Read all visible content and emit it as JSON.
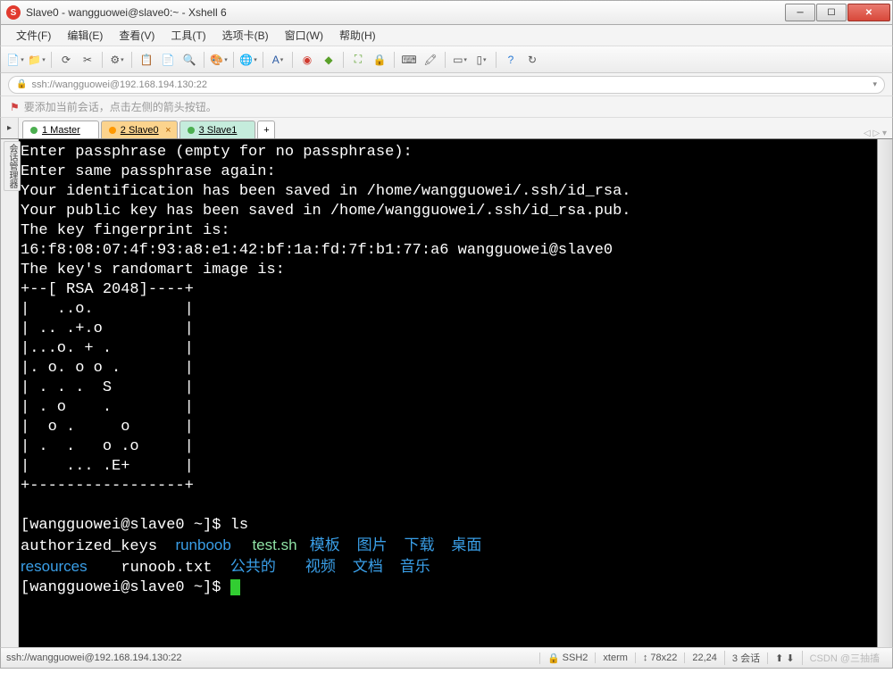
{
  "window": {
    "title": "Slave0 - wangguowei@slave0:~ - Xshell 6",
    "app_icon_glyph": "S"
  },
  "menubar": [
    "文件(F)",
    "编辑(E)",
    "查看(V)",
    "工具(T)",
    "选项卡(B)",
    "窗口(W)",
    "帮助(H)"
  ],
  "addressbar": {
    "text": "ssh://wangguowei@192.168.194.130:22"
  },
  "hint": "要添加当前会话，点击左侧的箭头按钮。",
  "side_handle_label": "会话管理器",
  "tabs": [
    {
      "id": "master",
      "label": "1 Master",
      "state": "green",
      "active": false
    },
    {
      "id": "slave0",
      "label": "2 Slave0",
      "state": "orange",
      "active": true
    },
    {
      "id": "slave1",
      "label": "3 Slave1",
      "state": "green",
      "active": false
    }
  ],
  "terminal": {
    "lines": [
      "Enter passphrase (empty for no passphrase):",
      "Enter same passphrase again:",
      "Your identification has been saved in /home/wangguowei/.ssh/id_rsa.",
      "Your public key has been saved in /home/wangguowei/.ssh/id_rsa.pub.",
      "The key fingerprint is:",
      "16:f8:08:07:4f:93:a8:e1:42:bf:1a:fd:7f:b1:77:a6 wangguowei@slave0",
      "The key's randomart image is:",
      "+--[ RSA 2048]----+",
      "|   ..o.          |",
      "| .. .+.o         |",
      "|...o. + .        |",
      "|. o. o o .       |",
      "| . . .  S        |",
      "| . o    .        |",
      "|  o .     o      |",
      "| .  .   o .o     |",
      "|    ... .E+      |",
      "+-----------------+",
      ""
    ],
    "prompt1": "[wangguowei@slave0 ~]$ ls",
    "ls_row1": [
      {
        "text": "authorized_keys",
        "cls": ""
      },
      {
        "text": "runboob",
        "cls": "c-blue"
      },
      {
        "text": "test.sh",
        "cls": "c-cyan"
      },
      {
        "text": "模板",
        "cls": "c-blue"
      },
      {
        "text": "图片",
        "cls": "c-blue"
      },
      {
        "text": "下载",
        "cls": "c-blue"
      },
      {
        "text": "桌面",
        "cls": "c-blue"
      }
    ],
    "ls_row2": [
      {
        "text": "resources",
        "cls": "c-blue"
      },
      {
        "text": "runoob.txt",
        "cls": ""
      },
      {
        "text": "公共的",
        "cls": "c-blue"
      },
      {
        "text": "视频",
        "cls": "c-blue"
      },
      {
        "text": "文档",
        "cls": "c-blue"
      },
      {
        "text": "音乐",
        "cls": "c-blue"
      }
    ],
    "prompt2": "[wangguowei@slave0 ~]$ "
  },
  "statusbar": {
    "left": "ssh://wangguowei@192.168.194.130:22",
    "protocol": "SSH2",
    "term_type": "xterm",
    "size": "78x22",
    "cursor": "22,24",
    "sessions": "3 会话",
    "watermark": "CSDN @三抽搐"
  }
}
